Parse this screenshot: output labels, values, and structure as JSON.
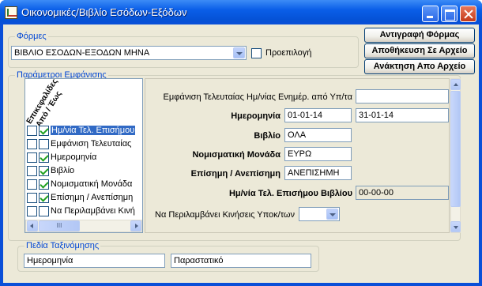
{
  "window": {
    "title": "Οικονομικές/Βιβλίο Εσόδων-Εξόδων"
  },
  "forms": {
    "legend": "Φόρμες",
    "selected": "ΒΙΒΛΙΟ ΕΣΟΔΩΝ-ΕΞΟΔΩΝ ΜΗΝΑ",
    "preselect_label": "Προεπιλογή",
    "preselect_checked": false
  },
  "buttons": {
    "copy_form": "Αντιγραφή Φόρμας",
    "save_to_file": "Αποθήκευση Σε Αρχείο",
    "load_from_file": "Ανάκτηση Απο Αρχείο"
  },
  "params": {
    "legend": "Παράμετροι Εμφάνισης",
    "col_header_1": "Επικεφαλίδες",
    "col_header_2": "Από / Έως",
    "items": [
      {
        "label": "Ημ/νία Τελ. Επισήμου",
        "col1": false,
        "col2": true,
        "selected": true
      },
      {
        "label": "Εμφάνιση Τελευταίας",
        "col1": false,
        "col2": false,
        "selected": false
      },
      {
        "label": "Ημερομηνία",
        "col1": false,
        "col2": true,
        "selected": false
      },
      {
        "label": "Βιβλίο",
        "col1": false,
        "col2": true,
        "selected": false
      },
      {
        "label": "Νομισματική Μονάδα",
        "col1": false,
        "col2": true,
        "selected": false
      },
      {
        "label": "Επίσημη / Ανεπίσημη",
        "col1": false,
        "col2": true,
        "selected": false
      },
      {
        "label": "Να Περιλαμβάνει Κινή",
        "col1": false,
        "col2": false,
        "selected": false
      }
    ],
    "scroll_glyph": "III"
  },
  "detail": {
    "last_update_label": "Εμφάνιση Τελευταίας Ημ/νίας Ενημέρ. από Υπ/τα",
    "last_update_value": "",
    "date_label": "Ημερομηνία",
    "date_from": "01-01-14",
    "date_to": "31-01-14",
    "book_label": "Βιβλίο",
    "book_value": "ΟΛΑ",
    "currency_label": "Νομισματική Μονάδα",
    "currency_value": "ΕΥΡΩ",
    "official_label": "Επίσημη / Ανεπίσημη",
    "official_value": "ΑΝΕΠΙΣΗΜΗ",
    "last_official_label": "Ημ/νία Τελ. Επισήμου Βιβλίου",
    "last_official_value": "00-00-00",
    "include_moves_label": "Να Περιλαμβάνει Κινήσεις Υποκ/των",
    "include_moves_value": ""
  },
  "sort": {
    "legend": "Πεδία Ταξινόμησης",
    "field1": "Ημερομηνία",
    "field2": "Παραστατικό"
  },
  "colors": {
    "accent": "#0046d5",
    "selection": "#316ac5",
    "titlebar": "#0a4fd8",
    "face": "#ece9d8"
  }
}
